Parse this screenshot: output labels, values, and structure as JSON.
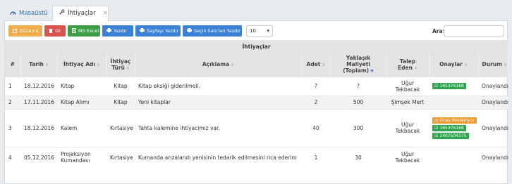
{
  "tabs": [
    {
      "label": "Masaüstü",
      "icon": "dashboard-icon"
    },
    {
      "label": "İhtiyaçlar",
      "icon": "wrench-icon",
      "close": "×"
    }
  ],
  "toolbar": {
    "edit": "Düzenle",
    "delete": "Sil",
    "excel": "MS Excel",
    "print": "Yazdır",
    "print_page": "Sayfayı Yazdır",
    "print_selected": "Seçili Satırları Yazdır",
    "page_size": "10"
  },
  "search": {
    "label": "Ara:",
    "value": ""
  },
  "table": {
    "caption": "İhtiyaçlar",
    "columns": {
      "no": "#",
      "date": "Tarih",
      "name": "İhtiyaç Adı",
      "type": "İhtiyaç Türü",
      "desc": "Açıklama",
      "qty": "Adet",
      "cost": "Yaklaşık Maliyeti (Toplam)",
      "requester": "Talep Eden",
      "approvals": "Onaylar",
      "status": "Durum"
    },
    "rows": [
      {
        "no": "1",
        "date": "18.12.2016",
        "name": "Kitap",
        "type": "Kitap",
        "desc": "Kitap eksiği giderilmeli.",
        "qty": "?",
        "cost": "?",
        "requester": "Uğur Tekbacak",
        "approvals": [
          {
            "text": "165376168",
            "kind": "approved"
          }
        ],
        "status": "Onaylandı"
      },
      {
        "no": "2",
        "date": "17.11.2016",
        "name": "Kitap Alımı",
        "type": "Kitap",
        "desc": "Yeni kitaplar",
        "qty": "2",
        "cost": "500",
        "requester": "Şimşek Mert",
        "approvals": [],
        "status": "Onaylandı"
      },
      {
        "no": "3",
        "date": "18.12.2016",
        "name": "Kalem",
        "type": "Kırtasiye",
        "desc": "Tahta kalemine ihtiyacımız var.",
        "qty": "40",
        "cost": "300",
        "requester": "Uğur Tekbacak",
        "approvals": [
          {
            "text": "Onay Bekleniyor",
            "kind": "pending"
          },
          {
            "text": "165376168",
            "kind": "approved"
          },
          {
            "text": "2407504375",
            "kind": "approved"
          }
        ],
        "status": "Onaylandı"
      },
      {
        "no": "4",
        "date": "05.12.2016",
        "name": "Projeksiyon Kumandası",
        "type": "Kırtasiye",
        "desc": "Kumanda arızalandı yenisinin tedarik edilmesini rica ederim",
        "qty": "1",
        "cost": "30",
        "requester": "Uğur Tekbacak",
        "approvals": [],
        "status": "Onaylandı"
      }
    ]
  }
}
